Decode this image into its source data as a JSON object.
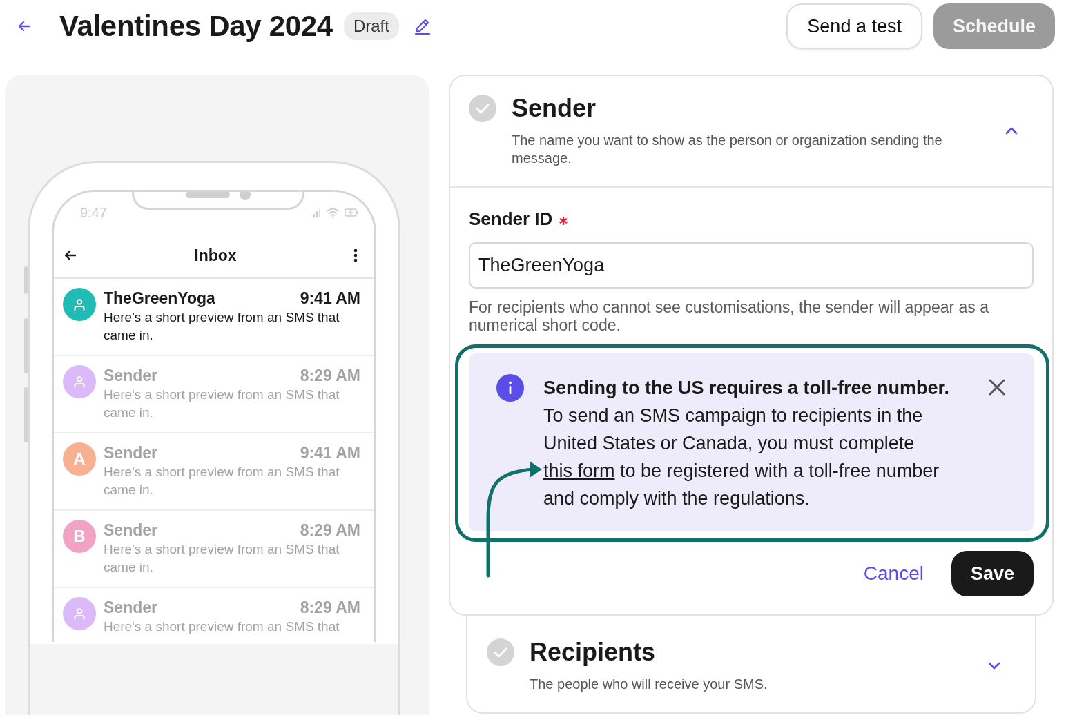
{
  "header": {
    "title": "Valentines Day 2024",
    "status": "Draft",
    "buttons": [
      {
        "label": "Send a test",
        "kind": "secondary",
        "disabled": false
      },
      {
        "label": "Schedule",
        "kind": "primary",
        "disabled": true
      }
    ]
  },
  "phone": {
    "time": "9:47",
    "title": "Inbox",
    "messages": [
      {
        "sender": "TheGreenYoga",
        "time": "9:41 AM",
        "preview": "Here's a short preview from an SMS that came in.",
        "unread": true,
        "avatar": {
          "kind": "icon",
          "color": "#21bbb6"
        }
      },
      {
        "sender": "Sender",
        "time": "8:29 AM",
        "preview": "Here's a short preview from an SMS that came in.",
        "unread": false,
        "avatar": {
          "kind": "icon",
          "color": "#dcb9f9"
        }
      },
      {
        "sender": "Sender",
        "time": "9:41 AM",
        "preview": "Here's a short preview from an SMS that came in.",
        "unread": false,
        "avatar": {
          "kind": "letter",
          "letter": "A",
          "color": "#f8b093"
        }
      },
      {
        "sender": "Sender",
        "time": "8:29 AM",
        "preview": "Here's a short preview from an SMS that came in.",
        "unread": false,
        "avatar": {
          "kind": "letter",
          "letter": "B",
          "color": "#f0a3c4"
        }
      },
      {
        "sender": "Sender",
        "time": "8:29 AM",
        "preview": "Here's a short preview from an SMS that",
        "unread": false,
        "avatar": {
          "kind": "icon",
          "color": "#dcb9f9"
        }
      }
    ]
  },
  "sections": [
    {
      "title": "Sender",
      "description": "The name you want to show as the person or organization sending the message.",
      "expanded": true,
      "field": {
        "label": "Sender ID",
        "required": true,
        "value": "TheGreenYoga"
      },
      "help": "For recipients who cannot see customisations, the sender will appear as a numerical short code.",
      "notice": {
        "title": "Sending to the US requires a toll-free number.",
        "body_before": "To send an SMS campaign to recipients in the United States or Canada, you must complete ",
        "link": "this form",
        "body_after": " to be registered with a toll-free number and comply with the regulations."
      },
      "actions": [
        {
          "label": "Cancel",
          "kind": "link"
        },
        {
          "label": "Save",
          "kind": "primary"
        }
      ]
    },
    {
      "title": "Recipients",
      "description": "The people who will receive your SMS.",
      "expanded": false
    }
  ]
}
